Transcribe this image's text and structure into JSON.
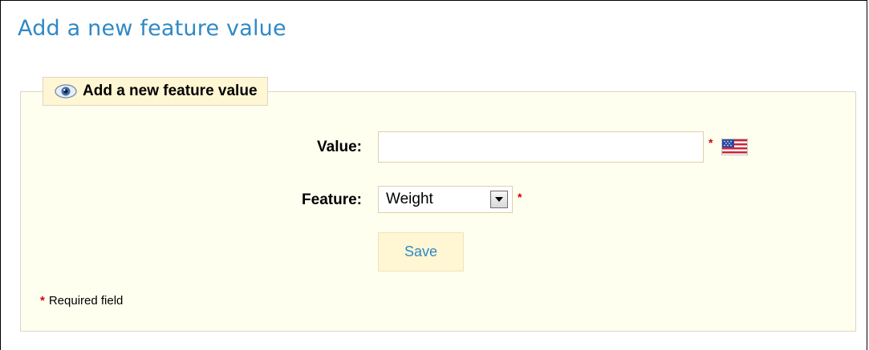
{
  "page": {
    "title": "Add a new feature value"
  },
  "form": {
    "legend": "Add a new feature value",
    "legend_icon": "eye-icon",
    "value_label": "Value:",
    "value_input_value": "",
    "required_marker": "*",
    "language_flag": "us-flag-icon",
    "feature_label": "Feature:",
    "feature_selected": "Weight",
    "save_label": "Save",
    "required_note": "Required field"
  },
  "colors": {
    "title": "#2f89c5",
    "panel_bg": "#fffff0",
    "legend_bg": "#fff6d3",
    "required": "#cc0000",
    "button_text": "#2f89c5"
  }
}
